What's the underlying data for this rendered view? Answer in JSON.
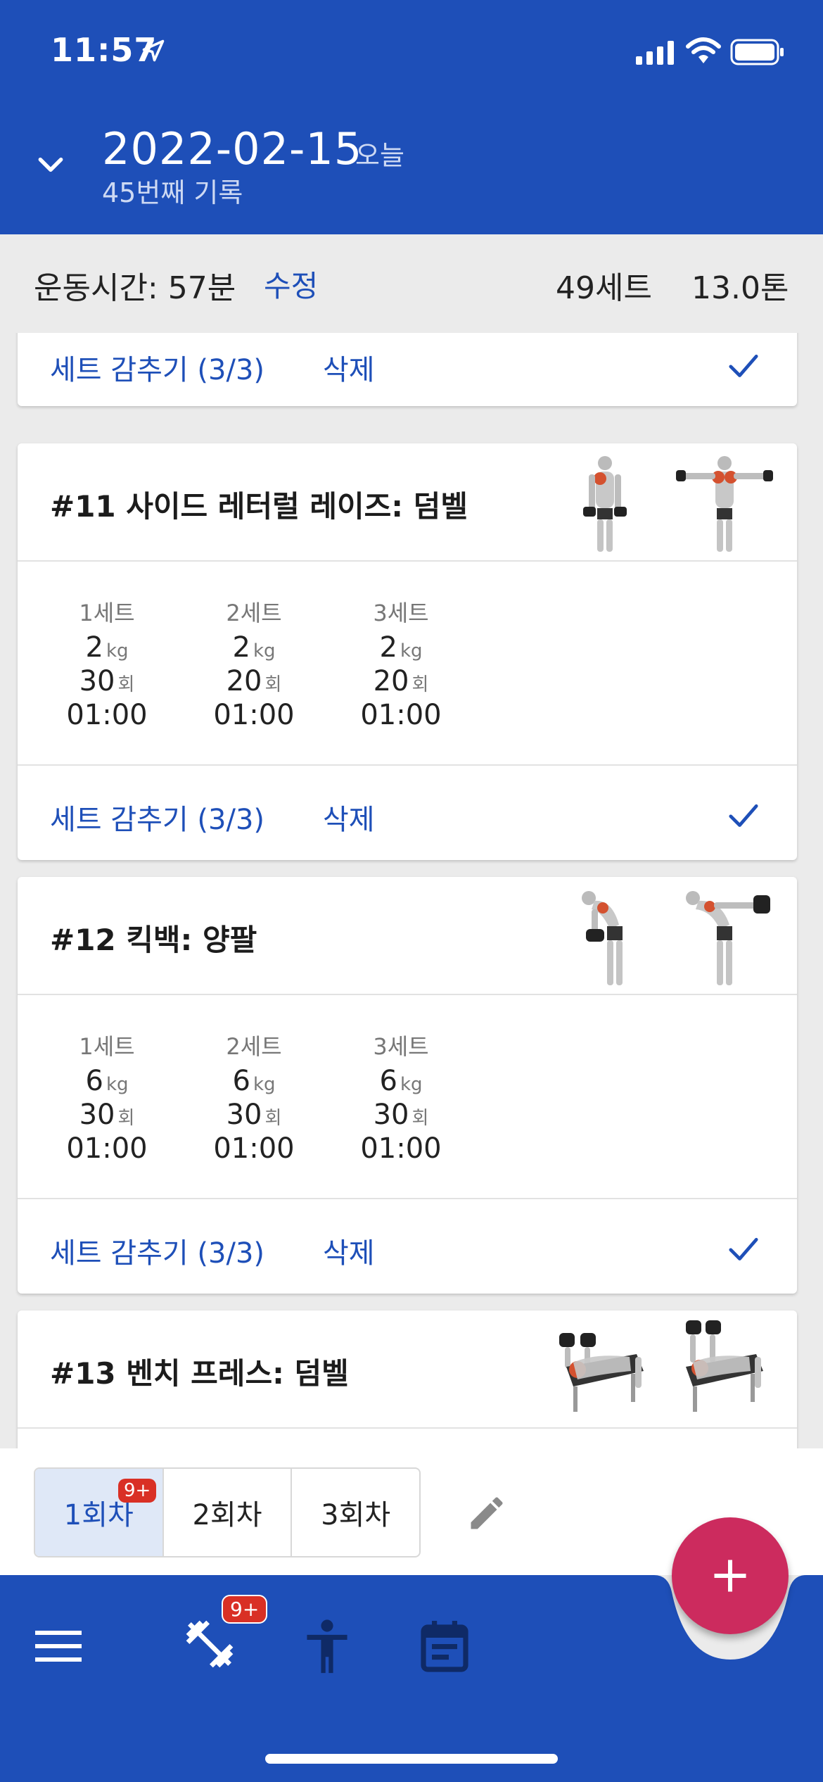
{
  "status": {
    "time": "11:57"
  },
  "header": {
    "date": "2022-02-15",
    "today": "오늘",
    "record_count": "45번째 기록"
  },
  "summary": {
    "workout_time": "운동시간: 57분",
    "edit": "수정",
    "total_sets": "49세트",
    "total_tons": "13.0톤"
  },
  "cards": [
    {
      "footer": {
        "hide_sets": "세트 감추기 (3/3)",
        "delete": "삭제"
      }
    },
    {
      "title": "#11 사이드 레터럴 레이즈: 덤벨",
      "sets": [
        {
          "label": "1세트",
          "weight": "2",
          "weight_unit": "kg",
          "reps": "30",
          "reps_unit": "회",
          "time": "01:00"
        },
        {
          "label": "2세트",
          "weight": "2",
          "weight_unit": "kg",
          "reps": "20",
          "reps_unit": "회",
          "time": "01:00"
        },
        {
          "label": "3세트",
          "weight": "2",
          "weight_unit": "kg",
          "reps": "20",
          "reps_unit": "회",
          "time": "01:00"
        }
      ],
      "footer": {
        "hide_sets": "세트 감추기 (3/3)",
        "delete": "삭제"
      }
    },
    {
      "title": "#12 킥백: 양팔",
      "sets": [
        {
          "label": "1세트",
          "weight": "6",
          "weight_unit": "kg",
          "reps": "30",
          "reps_unit": "회",
          "time": "01:00"
        },
        {
          "label": "2세트",
          "weight": "6",
          "weight_unit": "kg",
          "reps": "30",
          "reps_unit": "회",
          "time": "01:00"
        },
        {
          "label": "3세트",
          "weight": "6",
          "weight_unit": "kg",
          "reps": "30",
          "reps_unit": "회",
          "time": "01:00"
        }
      ],
      "footer": {
        "hide_sets": "세트 감추기 (3/3)",
        "delete": "삭제"
      }
    },
    {
      "title": "#13 벤치 프레스: 덤벨"
    }
  ],
  "sessions": {
    "tabs": [
      "1회차",
      "2회차",
      "3회차"
    ],
    "active_badge": "9+"
  },
  "nav": {
    "workout_badge": "9+"
  },
  "colors": {
    "primary": "#1e4fb8",
    "fab": "#cc2b5e",
    "badge": "#d93025"
  }
}
